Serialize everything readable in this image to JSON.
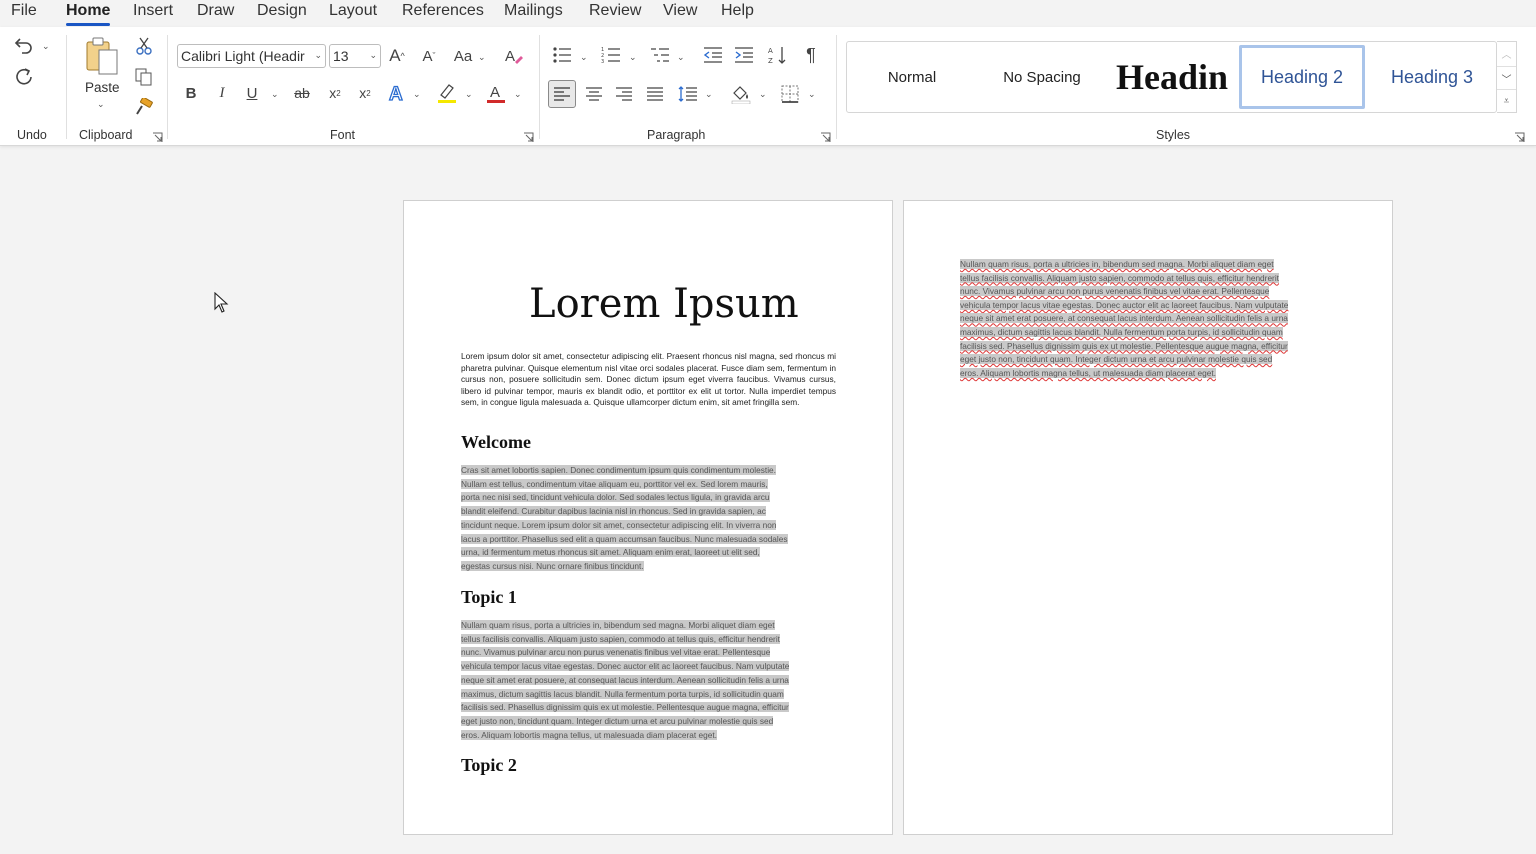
{
  "menu": {
    "items": [
      "File",
      "Home",
      "Insert",
      "Draw",
      "Design",
      "Layout",
      "References",
      "Mailings",
      "Review",
      "View",
      "Help"
    ],
    "active": "Home"
  },
  "ribbon": {
    "undo_group": {
      "label": "Undo"
    },
    "clipboard_group": {
      "label": "Clipboard",
      "paste_label": "Paste"
    },
    "font_group": {
      "label": "Font",
      "font_name": "Calibri Light (Headir",
      "font_size": "13",
      "change_case": "Aa"
    },
    "paragraph_group": {
      "label": "Paragraph"
    },
    "styles_group": {
      "label": "Styles",
      "items": [
        "Normal",
        "No Spacing",
        "Headin",
        "Heading 2",
        "Heading 3"
      ],
      "selected": "Heading 2"
    }
  },
  "colors": {
    "accent": "#1a56c4",
    "highlight": "#f5e800",
    "font_color": "#d12a2a",
    "heading_style": "#2f5496",
    "selection": "#c9c9c9"
  },
  "page1": {
    "title": "Lorem Ipsum",
    "intro_paragraph": "Lorem ipsum dolor sit amet, consectetur adipiscing elit. Praesent rhoncus nisl magna, sed rhoncus mi pharetra pulvinar. Quisque elementum nisl vitae orci sodales placerat. Fusce diam sem, fermentum in cursus non, posuere sollicitudin sem. Donec dictum ipsum eget viverra faucibus. Vivamus cursus, libero id pulvinar tempor, mauris ex blandit odio, et porttitor ex elit ut tortor. Nulla imperdiet tempus sem, in congue ligula malesuada a. Quisque ullamcorper dictum enim, sit amet fringilla sem.",
    "heading_welcome": "Welcome",
    "welcome_lines": [
      "Cras sit amet lobortis sapien. Donec condimentum ipsum quis condimentum molestie.",
      "Nullam est tellus, condimentum vitae aliquam eu, porttitor vel ex. Sed lorem mauris,",
      "porta nec nisi sed, tincidunt vehicula dolor. Sed sodales lectus ligula, in gravida arcu",
      "blandit eleifend. Curabitur dapibus lacinia nisl in rhoncus. Sed in gravida sapien, ac",
      "tincidunt neque. Lorem ipsum dolor sit amet, consectetur adipiscing elit. In viverra non",
      "lacus a porttitor. Phasellus sed elit a quam accumsan faucibus. Nunc malesuada sodales",
      "urna, id fermentum metus rhoncus sit amet. Aliquam enim erat, laoreet ut elit sed,",
      "egestas cursus nisi. Nunc ornare finibus tincidunt."
    ],
    "heading_topic1": "Topic 1",
    "topic1_lines": [
      "Nullam quam risus, porta a ultricies in, bibendum sed magna. Morbi aliquet diam eget",
      "tellus facilisis convallis. Aliquam justo sapien, commodo at tellus quis, efficitur hendrerit",
      "nunc. Vivamus pulvinar arcu non purus venenatis finibus vel vitae erat. Pellentesque",
      "vehicula tempor lacus vitae egestas. Donec auctor elit ac laoreet faucibus. Nam vulputate",
      "neque sit amet erat posuere, at consequat lacus interdum. Aenean sollicitudin felis a urna",
      "maximus, dictum sagittis lacus blandit. Nulla fermentum porta turpis, id sollicitudin quam",
      "facilisis sed. Phasellus dignissim quis ex ut molestie. Pellentesque augue magna, efficitur",
      "eget justo non, tincidunt quam. Integer dictum urna et arcu pulvinar molestie quis sed",
      "eros. Aliquam lobortis magna tellus, ut malesuada diam placerat eget."
    ],
    "heading_topic2": "Topic 2"
  },
  "page2": {
    "lines": [
      "Nullam quam risus, porta a ultricies in, bibendum sed magna. Morbi aliquet diam eget",
      "tellus facilisis convallis. Aliquam justo sapien, commodo at tellus quis, efficitur hendrerit",
      "nunc. Vivamus pulvinar arcu non purus venenatis finibus vel vitae erat. Pellentesque",
      "vehicula tempor lacus vitae egestas. Donec auctor elit ac laoreet faucibus. Nam vulputate",
      "neque sit amet erat posuere, at consequat lacus interdum. Aenean sollicitudin felis a urna",
      "maximus, dictum sagittis lacus blandit. Nulla fermentum porta turpis, id sollicitudin quam",
      "facilisis sed. Phasellus dignissim quis ex ut molestie. Pellentesque augue magna, efficitur",
      "eget justo non, tincidunt quam. Integer dictum urna et arcu pulvinar molestie quis sed",
      "eros. Aliquam lobortis magna tellus, ut malesuada diam placerat eget."
    ]
  }
}
